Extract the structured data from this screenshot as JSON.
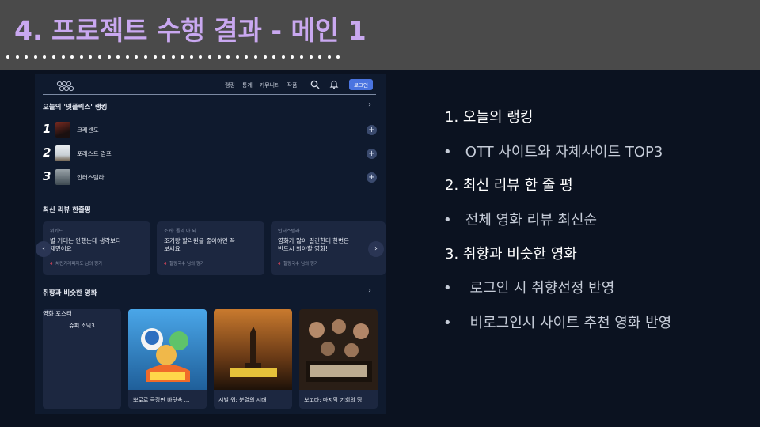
{
  "slide": {
    "title": "4. 프로젝트 수행 결과  - 메인 1"
  },
  "app": {
    "nav": [
      "랭킹",
      "통계",
      "커뮤니티",
      "작품"
    ],
    "login_label": "로그인"
  },
  "ranking": {
    "title": "오늘의 '넷플릭스' 랭킹",
    "items": [
      {
        "num": "1",
        "name": "크레센도"
      },
      {
        "num": "2",
        "name": "포레스트 검프"
      },
      {
        "num": "3",
        "name": "인터스텔라"
      }
    ]
  },
  "reviews": {
    "title": "최신 리뷰 한줄평",
    "cards": [
      {
        "source": "위키드",
        "text_1": "별 기대는 안했는데 생각보다",
        "text_2": "재밌어요",
        "likes": "4",
        "author": "치킨카레피자도 님의 평가"
      },
      {
        "source": "조커: 폴리 아 되",
        "text_1": "조커랑 할리퀸을 좋아하면 꼭",
        "text_2": "보세요",
        "likes": "4",
        "author": "할랑국수 님의 평가"
      },
      {
        "source": "인터스텔라",
        "text_1": "영화가 많이 길긴한데 한번은",
        "text_2": "반드시 봐야할 영화!!",
        "likes": "4",
        "author": "할랑국수 님의 평가"
      }
    ]
  },
  "similar": {
    "title": "취향과 비슷한 영화",
    "posters": [
      {
        "alt": "영화 포스터",
        "caption": "슈퍼 소닉3"
      },
      {
        "caption": "뽀로로 극장판 바닷속 ..."
      },
      {
        "caption": "시빌 워: 분열의 시대"
      },
      {
        "caption": "보고타: 마지막 기회의 땅"
      }
    ]
  },
  "bullets": {
    "items": [
      "1.  오늘의 랭킹",
      "OTT 사이트와 자체사이트   TOP3",
      "2.  최신 리뷰 한 줄 평",
      "전체 영화 리뷰 최신순",
      "3.  취향과 비슷한 영화",
      "로그인 시 취향선정 반영",
      "비로그인시 사이트 추천 영화  반영"
    ]
  },
  "colors": {
    "title": "#c9a8f0",
    "header_bg": "#4a4a4a",
    "slide_bg": "#0b1220",
    "accent": "#4a74e0",
    "heart": "#e0455a"
  }
}
